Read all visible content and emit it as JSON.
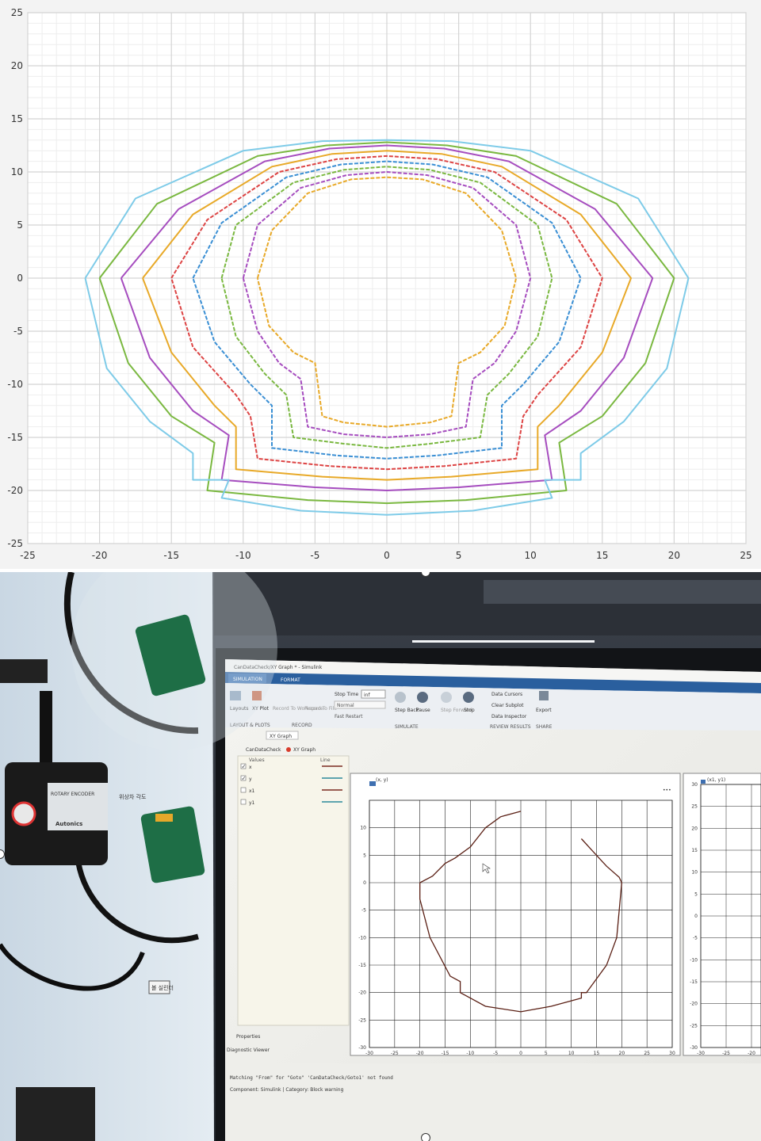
{
  "chart_data": [
    {
      "type": "line",
      "xlim": [
        -25,
        25
      ],
      "ylim": [
        -25,
        25
      ],
      "xticks": [
        -25,
        -20,
        -15,
        -10,
        -5,
        0,
        5,
        10,
        15,
        20,
        25
      ],
      "yticks": [
        25,
        20,
        15,
        10,
        5,
        0,
        -5,
        -10,
        -15,
        -20,
        -25
      ],
      "xtick_labels": [
        "-25",
        "-20",
        "-15",
        "-10",
        "-5",
        "0",
        "5",
        "10",
        "15",
        "20",
        "25"
      ],
      "ytick_labels": [
        "25",
        "20",
        "15",
        "10",
        "5",
        "0",
        "-5",
        "-10",
        "-15",
        "-20",
        "-25"
      ],
      "grid": true,
      "minor_grid": true,
      "series": [
        {
          "color": "#e8a928",
          "dashed": true,
          "points": [
            [
              -9,
              0
            ],
            [
              -8,
              4.5
            ],
            [
              -5.5,
              8
            ],
            [
              -2.5,
              9.3
            ],
            [
              0,
              9.5
            ],
            [
              2.5,
              9.3
            ],
            [
              5.5,
              8
            ],
            [
              8,
              4.5
            ],
            [
              9,
              0
            ],
            [
              8.2,
              -4.5
            ],
            [
              6.5,
              -7
            ],
            [
              5,
              -8
            ],
            [
              4.5,
              -13
            ],
            [
              3,
              -13.6
            ],
            [
              0,
              -14
            ],
            [
              -3,
              -13.6
            ],
            [
              -4.5,
              -13
            ],
            [
              -5,
              -8
            ],
            [
              -6.5,
              -7
            ],
            [
              -8.2,
              -4.5
            ],
            [
              -9,
              0
            ]
          ]
        },
        {
          "color": "#a64dbf",
          "dashed": true,
          "points": [
            [
              -10,
              0
            ],
            [
              -9,
              5
            ],
            [
              -6,
              8.5
            ],
            [
              -2.8,
              9.7
            ],
            [
              0,
              10
            ],
            [
              2.8,
              9.7
            ],
            [
              6,
              8.5
            ],
            [
              9,
              5
            ],
            [
              10,
              0
            ],
            [
              9,
              -5
            ],
            [
              7.5,
              -8
            ],
            [
              6,
              -9.5
            ],
            [
              5.5,
              -14
            ],
            [
              3,
              -14.7
            ],
            [
              0,
              -15
            ],
            [
              -3,
              -14.7
            ],
            [
              -5.5,
              -14
            ],
            [
              -6,
              -9.5
            ],
            [
              -7.5,
              -8
            ],
            [
              -9,
              -5
            ],
            [
              -10,
              0
            ]
          ]
        },
        {
          "color": "#7ab840",
          "dashed": true,
          "points": [
            [
              -11.5,
              0
            ],
            [
              -10.5,
              5
            ],
            [
              -6.5,
              9
            ],
            [
              -3,
              10.2
            ],
            [
              0,
              10.5
            ],
            [
              3,
              10.2
            ],
            [
              6.5,
              9
            ],
            [
              10.5,
              5
            ],
            [
              11.5,
              0
            ],
            [
              10.5,
              -5.5
            ],
            [
              8.5,
              -9
            ],
            [
              7,
              -11
            ],
            [
              6.5,
              -15
            ],
            [
              3,
              -15.6
            ],
            [
              0,
              -16
            ],
            [
              -3,
              -15.6
            ],
            [
              -6.5,
              -15
            ],
            [
              -7,
              -11
            ],
            [
              -8.5,
              -9
            ],
            [
              -10.5,
              -5.5
            ],
            [
              -11.5,
              0
            ]
          ]
        },
        {
          "color": "#3a8fd4",
          "dashed": true,
          "points": [
            [
              -13.5,
              0
            ],
            [
              -11.5,
              5.2
            ],
            [
              -7,
              9.5
            ],
            [
              -3.2,
              10.7
            ],
            [
              0,
              11
            ],
            [
              3.2,
              10.7
            ],
            [
              7,
              9.5
            ],
            [
              11.5,
              5.2
            ],
            [
              13.5,
              0
            ],
            [
              12,
              -6
            ],
            [
              9.5,
              -10
            ],
            [
              8,
              -12
            ],
            [
              8,
              -16
            ],
            [
              3.5,
              -16.7
            ],
            [
              0,
              -17
            ],
            [
              -3.5,
              -16.7
            ],
            [
              -8,
              -16
            ],
            [
              -8,
              -12
            ],
            [
              -9.5,
              -10
            ],
            [
              -12,
              -6
            ],
            [
              -13.5,
              0
            ]
          ]
        },
        {
          "color": "#dd4444",
          "dashed": true,
          "points": [
            [
              -15,
              0
            ],
            [
              -12.5,
              5.5
            ],
            [
              -7.5,
              10
            ],
            [
              -3.5,
              11.2
            ],
            [
              0,
              11.5
            ],
            [
              3.5,
              11.2
            ],
            [
              7.5,
              10
            ],
            [
              12.5,
              5.5
            ],
            [
              15,
              0
            ],
            [
              13.5,
              -6.5
            ],
            [
              10.5,
              -11
            ],
            [
              9.5,
              -13
            ],
            [
              9,
              -17
            ],
            [
              4,
              -17.7
            ],
            [
              0,
              -18
            ],
            [
              -4,
              -17.7
            ],
            [
              -9,
              -17
            ],
            [
              -9.5,
              -13
            ],
            [
              -10.5,
              -11
            ],
            [
              -13.5,
              -6.5
            ],
            [
              -15,
              0
            ]
          ]
        },
        {
          "color": "#e8a928",
          "dashed": false,
          "points": [
            [
              -17,
              0
            ],
            [
              -13.5,
              6
            ],
            [
              -8,
              10.5
            ],
            [
              -3.8,
              11.7
            ],
            [
              0,
              12
            ],
            [
              3.8,
              11.7
            ],
            [
              8,
              10.5
            ],
            [
              13.5,
              6
            ],
            [
              17,
              0
            ],
            [
              15,
              -7
            ],
            [
              12,
              -12
            ],
            [
              10.5,
              -14
            ],
            [
              10.5,
              -18
            ],
            [
              4.5,
              -18.7
            ],
            [
              0,
              -19
            ],
            [
              -4.5,
              -18.7
            ],
            [
              -10.5,
              -18
            ],
            [
              -10.5,
              -14
            ],
            [
              -12,
              -12
            ],
            [
              -15,
              -7
            ],
            [
              -17,
              0
            ]
          ]
        },
        {
          "color": "#a64dbf",
          "dashed": false,
          "points": [
            [
              -18.5,
              0
            ],
            [
              -14.5,
              6.5
            ],
            [
              -8.5,
              11
            ],
            [
              -4,
              12.2
            ],
            [
              0,
              12.5
            ],
            [
              4,
              12.2
            ],
            [
              8.5,
              11
            ],
            [
              14.5,
              6.5
            ],
            [
              18.5,
              0
            ],
            [
              16.5,
              -7.5
            ],
            [
              13.5,
              -12.5
            ],
            [
              11,
              -14.8
            ],
            [
              11.5,
              -19
            ],
            [
              5,
              -19.7
            ],
            [
              0,
              -20
            ],
            [
              -5,
              -19.7
            ],
            [
              -11.5,
              -19
            ],
            [
              -11,
              -14.8
            ],
            [
              -13.5,
              -12.5
            ],
            [
              -16.5,
              -7.5
            ],
            [
              -18.5,
              0
            ]
          ]
        },
        {
          "color": "#7ab840",
          "dashed": false,
          "points": [
            [
              -20,
              0
            ],
            [
              -16,
              7
            ],
            [
              -9,
              11.5
            ],
            [
              -4.2,
              12.5
            ],
            [
              0,
              12.8
            ],
            [
              4.2,
              12.5
            ],
            [
              9,
              11.5
            ],
            [
              16,
              7
            ],
            [
              20,
              0
            ],
            [
              18,
              -8
            ],
            [
              15,
              -13
            ],
            [
              12,
              -15.5
            ],
            [
              12.5,
              -20
            ],
            [
              5.5,
              -20.9
            ],
            [
              0,
              -21.2
            ],
            [
              -5.5,
              -20.9
            ],
            [
              -12.5,
              -20
            ],
            [
              -12,
              -15.5
            ],
            [
              -15,
              -13
            ],
            [
              -18,
              -8
            ],
            [
              -20,
              0
            ]
          ]
        },
        {
          "color": "#7ecbe8",
          "dashed": false,
          "points": [
            [
              -21,
              0
            ],
            [
              -17.5,
              7.5
            ],
            [
              -10,
              12
            ],
            [
              -4.5,
              12.9
            ],
            [
              0,
              13
            ],
            [
              4.5,
              12.9
            ],
            [
              10,
              12
            ],
            [
              17.5,
              7.5
            ],
            [
              21,
              0
            ],
            [
              19.5,
              -8.5
            ],
            [
              16.5,
              -13.5
            ],
            [
              13.5,
              -16.5
            ],
            [
              13.5,
              -19
            ],
            [
              11,
              -19
            ],
            [
              11.5,
              -20.7
            ],
            [
              6,
              -21.9
            ],
            [
              0,
              -22.3
            ],
            [
              -6,
              -21.9
            ],
            [
              -11.5,
              -20.7
            ],
            [
              -11,
              -19
            ],
            [
              -13.5,
              -19
            ],
            [
              -13.5,
              -16.5
            ],
            [
              -16.5,
              -13.5
            ],
            [
              -19.5,
              -8.5
            ],
            [
              -21,
              0
            ]
          ]
        }
      ]
    },
    {
      "type": "line",
      "title": "(x, y)",
      "xlim": [
        -30,
        30
      ],
      "ylim": [
        -30,
        15
      ],
      "xticks": [
        -30,
        -25,
        -20,
        -15,
        -10,
        -5,
        0,
        5,
        10,
        15,
        20,
        25,
        30
      ],
      "yticks": [
        10,
        5,
        0,
        -5,
        -10,
        -15,
        -20,
        -25,
        -30
      ],
      "xtick_labels": [
        "-30",
        "-25",
        "-20",
        "-15",
        "-10",
        "-5",
        "0",
        "5",
        "10",
        "15",
        "20",
        "25",
        "30"
      ],
      "ytick_labels": [
        "10",
        "5",
        "0",
        "-5",
        "-10",
        "-15",
        "-20",
        "-25",
        "-30"
      ],
      "grid": true,
      "series": [
        {
          "color": "#5a1f14",
          "points": [
            [
              0,
              13
            ],
            [
              -4,
              12
            ],
            [
              -7,
              10
            ],
            [
              -10,
              6.5
            ],
            [
              -13,
              4.5
            ],
            [
              -15,
              3.5
            ],
            [
              -17.5,
              1.2
            ],
            [
              -20,
              0
            ],
            [
              -20,
              -3
            ],
            [
              -18,
              -10
            ],
            [
              -14,
              -17
            ],
            [
              -12,
              -18
            ],
            [
              -12,
              -20
            ],
            [
              -10,
              -21
            ],
            [
              -7,
              -22.5
            ],
            [
              0,
              -23.5
            ],
            [
              6,
              -22.5
            ],
            [
              12,
              -21
            ],
            [
              12,
              -20
            ],
            [
              13,
              -20
            ],
            [
              17,
              -15
            ],
            [
              19,
              -10
            ],
            [
              20,
              0
            ],
            [
              19.5,
              1
            ],
            [
              17,
              3
            ],
            [
              14,
              6
            ],
            [
              12,
              8
            ]
          ]
        }
      ]
    },
    {
      "type": "line",
      "title": "(x1, y1)",
      "ylim": [
        -30,
        30
      ],
      "yticks": [
        30,
        25,
        20,
        15,
        10,
        5,
        0,
        -5,
        -10,
        -15,
        -20,
        -25,
        -30
      ],
      "ytick_labels": [
        "30",
        "25",
        "20",
        "15",
        "10",
        "5",
        "0",
        "-5",
        "-10",
        "-15",
        "-20",
        "-25",
        "-30"
      ],
      "xtick_labels": [
        "-30",
        "-25",
        "-20"
      ],
      "grid": true,
      "series": []
    }
  ],
  "photo": {
    "window_title": "CanDataCheck/XY Graph * - Simulink",
    "tabs": [
      "SIMULATION",
      "FORMAT"
    ],
    "toolbar": {
      "stop_time_label": "Stop Time",
      "stop_time_value": "inf",
      "mode_value": "Normal",
      "fast_restart": "Fast Restart",
      "layouts": "Layouts",
      "xy_plot": "XY Plot",
      "record_workspace": "Record To Workspace",
      "record_file": "Record To File",
      "step_back": "Step Back",
      "pause": "Pause",
      "step_forward": "Step Forward",
      "stop": "Stop",
      "data_cursors": "Data Cursors",
      "clear_subplot": "Clear Subplot",
      "data_inspector": "Data Inspector",
      "export": "Export",
      "section_layout": "LAYOUT & PLOTS",
      "section_record": "RECORD",
      "section_simulate": "SIMULATE",
      "section_review": "REVIEW RESULTS",
      "section_share": "SHARE"
    },
    "block_tab": "XY Graph",
    "breadcrumb": [
      "CanDataCheck",
      "XY Graph"
    ],
    "signals_header": [
      "Values",
      "Line"
    ],
    "signals": [
      {
        "name": "x",
        "checked": true,
        "color": "#7a2a20"
      },
      {
        "name": "y",
        "checked": true,
        "color": "#2b8a9a"
      },
      {
        "name": "x1",
        "checked": false,
        "color": "#7a2a20"
      },
      {
        "name": "y1",
        "checked": false,
        "color": "#2b8a9a"
      }
    ],
    "properties_label": "Properties",
    "diagnostic_label": "Diagnostic Viewer",
    "diag_message": "Matching \"From\" for \"Goto\" 'CanDataCheck/Goto1' not found",
    "diag_detail": "Component: Simulink | Category: Block warning",
    "panel_labels": [
      "ROTARY ENCODER",
      "Autonics"
    ],
    "korean_labels": [
      "위상차 각도",
      "볼 실린더"
    ]
  }
}
